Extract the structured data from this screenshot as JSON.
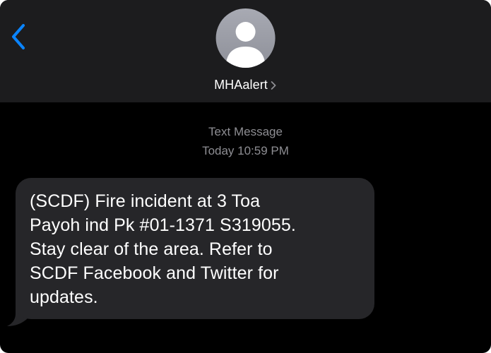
{
  "colors": {
    "background": "#000000",
    "header_background": "#1c1c1e",
    "accent": "#0a84ff",
    "bubble": "#262629",
    "secondary_text": "#8e8e93"
  },
  "header": {
    "back_icon": "chevron-left-icon",
    "contact": {
      "avatar_icon": "person-silhouette-icon",
      "name": "MHAalert",
      "disclosure_icon": "chevron-right-icon"
    }
  },
  "conversation": {
    "message_type": "Text Message",
    "timestamp": "Today 10:59 PM",
    "messages": [
      {
        "direction": "incoming",
        "lines": [
          "(SCDF) Fire incident at 3 Toa",
          "Payoh ind Pk #01-1371 S319055.",
          "Stay clear of the area. Refer to",
          "SCDF Facebook and Twitter for",
          "updates."
        ]
      }
    ]
  }
}
